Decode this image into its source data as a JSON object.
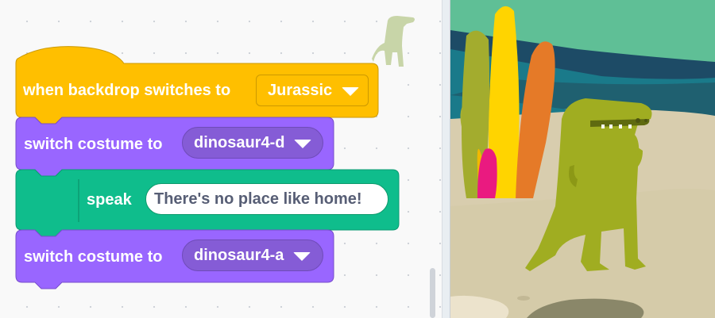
{
  "hat_block": {
    "text": "when backdrop switches to",
    "dropdown_value": "Jurassic",
    "color": "#ffbf00"
  },
  "looks_block_1": {
    "text": "switch costume to",
    "dropdown_value": "dinosaur4-d",
    "color": "#9966ff"
  },
  "speak_block": {
    "text": "speak",
    "input_value": "There's no place like home!",
    "color": "#0fbd8c",
    "icon": "text-to-speech-extension"
  },
  "looks_block_2": {
    "text": "switch costume to",
    "dropdown_value": "dinosaur4-a",
    "color": "#9966ff"
  },
  "sprite_thumbnail": {
    "icon": "dinosaur-sprite-ghost-icon"
  },
  "stage": {
    "sprite": "dinosaur4",
    "backdrop": "Jurassic"
  }
}
